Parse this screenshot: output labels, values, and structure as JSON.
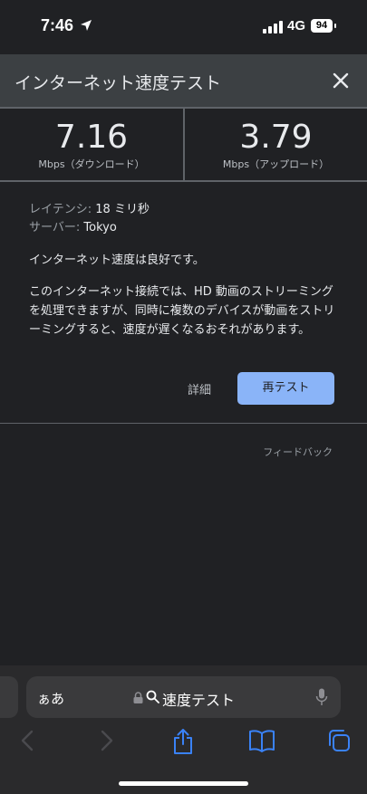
{
  "status_bar": {
    "time": "7:46",
    "network": "4G",
    "battery": "94"
  },
  "widget": {
    "title": "インターネット速度テスト",
    "download": {
      "value": "7.16",
      "unit": "Mbps（ダウンロード）"
    },
    "upload": {
      "value": "3.79",
      "unit": "Mbps（アップロード）"
    },
    "latency_label": "レイテンシ:",
    "latency_value": "18 ミリ秒",
    "server_label": "サーバー:",
    "server_value": "Tokyo",
    "status": "インターネット速度は良好です。",
    "description": "このインターネット接続では、HD 動画のストリーミングを処理できますが、同時に複数のデバイスが動画をストリーミングすると、速度が遅くなるおそれがあります。",
    "details_label": "詳細",
    "retest_label": "再テスト",
    "feedback_label": "フィードバック"
  },
  "safari": {
    "aa_label": "ぁあ",
    "url_text": "速度テスト"
  },
  "colors": {
    "accent": "#8ab4f8",
    "background": "#202124",
    "header": "#3c4043"
  }
}
